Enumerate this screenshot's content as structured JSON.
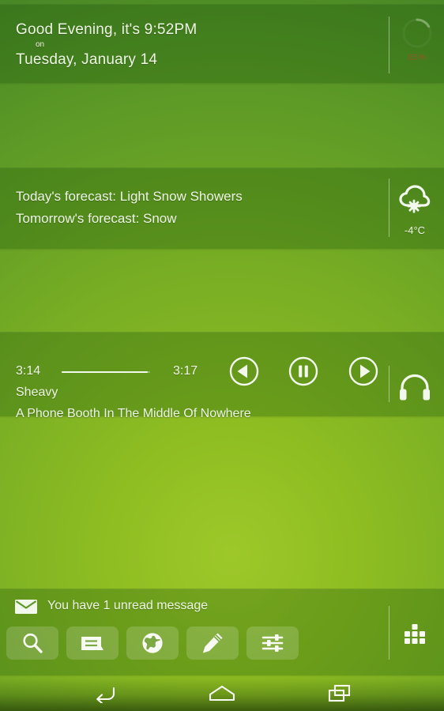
{
  "theme": {
    "background_green_light": "#9ec82a",
    "background_green_dark": "#3f7d23",
    "panel_overlay": "rgba(28,82,10,0.30)",
    "text_color": "#eef7e4",
    "battery_text_color": "#a0522d"
  },
  "greeting": {
    "line1": "Good Evening, it's 9:52PM",
    "on": "on",
    "line2": "Tuesday, January 14",
    "battery_percent": "85%",
    "battery_icon": "battery-arc-icon"
  },
  "weather": {
    "today": "Today's forecast: Light Snow Showers",
    "tomorrow": "Tomorrow's forecast: Snow",
    "temperature": "-4°C",
    "icon": "snow-cloud-icon"
  },
  "music": {
    "elapsed": "3:14",
    "total": "3:17",
    "progress_percent": 97,
    "artist": "Sheavy",
    "title": "A Phone Booth In The Middle Of Nowhere",
    "controls": {
      "previous": "previous-track-button",
      "pause": "pause-button",
      "next": "next-track-button"
    },
    "icon": "headphones-icon"
  },
  "notification": {
    "icon": "envelope-icon",
    "text": "You have 1 unread message"
  },
  "dock": {
    "items": [
      {
        "name": "search",
        "icon": "search-icon"
      },
      {
        "name": "messaging",
        "icon": "message-bubble-icon"
      },
      {
        "name": "browser",
        "icon": "globe-icon"
      },
      {
        "name": "notes",
        "icon": "pencil-icon"
      },
      {
        "name": "settings",
        "icon": "sliders-icon"
      }
    ],
    "app_drawer": "app-drawer-grid-icon"
  },
  "navbar": {
    "back": "back-icon",
    "home": "home-icon",
    "recents": "recents-icon"
  }
}
